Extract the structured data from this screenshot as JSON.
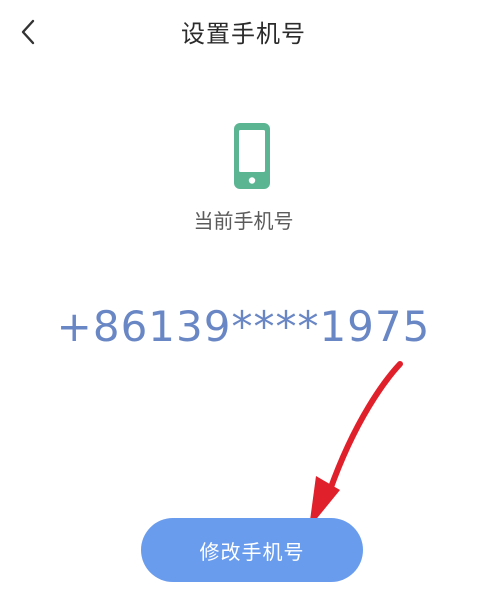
{
  "header": {
    "title": "设置手机号",
    "back_icon": "chevron-left-icon"
  },
  "main": {
    "icon": "mobile-phone-icon",
    "current_label": "当前手机号",
    "phone_number": "+86139****1975",
    "change_button_label": "修改手机号"
  },
  "colors": {
    "accent": "#6A9CEE",
    "number": "#6A87C5",
    "phone_icon": "#5CB592",
    "annotation_arrow": "#E0202A"
  }
}
